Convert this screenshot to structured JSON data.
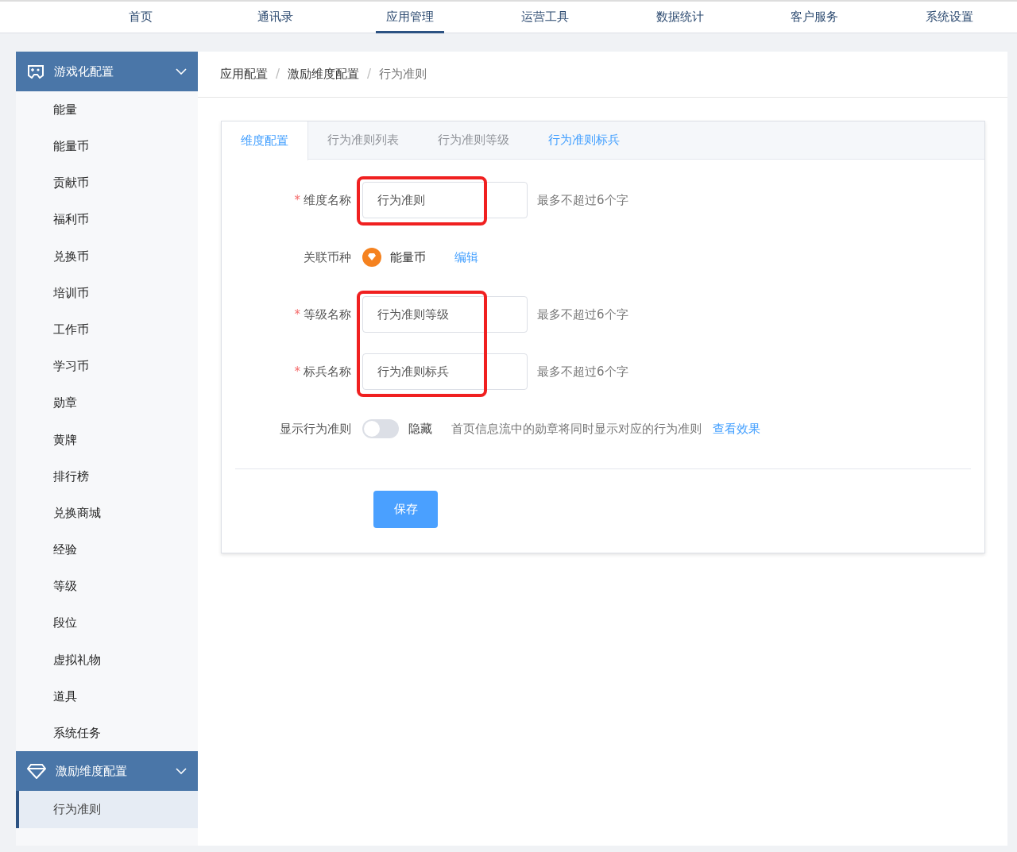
{
  "top_nav": [
    {
      "label": "首页",
      "selected": false
    },
    {
      "label": "通讯录",
      "selected": false
    },
    {
      "label": "应用管理",
      "selected": true
    },
    {
      "label": "运营工具",
      "selected": false
    },
    {
      "label": "数据统计",
      "selected": false
    },
    {
      "label": "客户服务",
      "selected": false
    },
    {
      "label": "系统设置",
      "selected": false
    }
  ],
  "sidebar": {
    "groups": [
      {
        "title": "游戏化配置",
        "expanded": true,
        "items": [
          {
            "label": "能量",
            "selected": false
          },
          {
            "label": "能量币",
            "selected": false
          },
          {
            "label": "贡献币",
            "selected": false
          },
          {
            "label": "福利币",
            "selected": false
          },
          {
            "label": "兑换币",
            "selected": false
          },
          {
            "label": "培训币",
            "selected": false
          },
          {
            "label": "工作币",
            "selected": false
          },
          {
            "label": "学习币",
            "selected": false
          },
          {
            "label": "勋章",
            "selected": false
          },
          {
            "label": "黄牌",
            "selected": false
          },
          {
            "label": "排行榜",
            "selected": false
          },
          {
            "label": "兑换商城",
            "selected": false
          },
          {
            "label": "经验",
            "selected": false
          },
          {
            "label": "等级",
            "selected": false
          },
          {
            "label": "段位",
            "selected": false
          },
          {
            "label": "虚拟礼物",
            "selected": false
          },
          {
            "label": "道具",
            "selected": false
          },
          {
            "label": "系统任务",
            "selected": false
          }
        ]
      },
      {
        "title": "激励维度配置",
        "expanded": true,
        "items": [
          {
            "label": "行为准则",
            "selected": true
          }
        ]
      }
    ]
  },
  "breadcrumb": [
    {
      "kind": "link",
      "text": "应用配置"
    },
    {
      "kind": "separator",
      "text": "/"
    },
    {
      "kind": "link",
      "text": "激励维度配置"
    },
    {
      "kind": "separator",
      "text": "/"
    },
    {
      "kind": "current",
      "text": "行为准则"
    }
  ],
  "tabs": [
    {
      "label": "维度配置",
      "selected": true,
      "hovered": false
    },
    {
      "label": "行为准则列表",
      "selected": false,
      "hovered": false
    },
    {
      "label": "行为准则等级",
      "selected": false,
      "hovered": false
    },
    {
      "label": "行为准则标兵",
      "selected": false,
      "hovered": true
    }
  ],
  "form": [
    {
      "kind": "input",
      "label": "维度名称",
      "required_mark": "*",
      "value": "行为准则",
      "hint": "最多不超过6个字",
      "highlighted": true
    },
    {
      "kind": "currency",
      "label": "关联币种",
      "currency": "能量币",
      "link": "编辑"
    },
    {
      "kind": "input",
      "label": "等级名称",
      "required_mark": "*",
      "value": "行为准则等级",
      "hint": "最多不超过6个字",
      "highlighted": true
    },
    {
      "kind": "input",
      "label": "标兵名称",
      "required_mark": "*",
      "value": "行为准则标兵",
      "hint": "最多不超过6个字",
      "highlighted": true
    },
    {
      "kind": "switch",
      "label": "显示行为准则",
      "on": false,
      "state_text": "隐藏",
      "hint": "首页信息流中的勋章将同时显示对应的行为准则",
      "link": "查看效果"
    }
  ],
  "save_button": "保存"
}
